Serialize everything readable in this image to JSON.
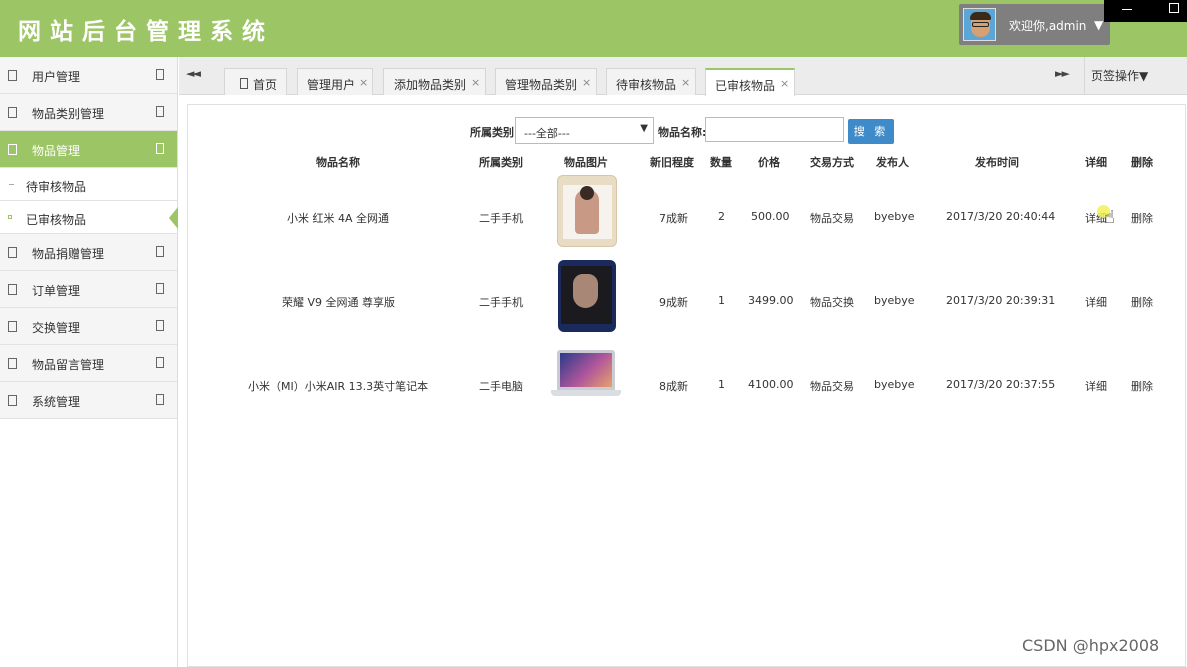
{
  "header": {
    "title": "网站后台管理系统",
    "user": {
      "welcome": "欢迎你,admin",
      "caret": "▼",
      "avatar_icon": "user-avatar"
    },
    "bg_color": "#9cc565"
  },
  "sidebar": {
    "items": [
      {
        "label": "用户管理"
      },
      {
        "label": "物品类别管理"
      },
      {
        "label": "物品管理",
        "active": true
      },
      {
        "label": "物品捐赠管理"
      },
      {
        "label": "订单管理"
      },
      {
        "label": "交换管理"
      },
      {
        "label": "物品留言管理"
      },
      {
        "label": "系统管理"
      }
    ],
    "subitems": [
      {
        "label": "待审核物品"
      },
      {
        "label": "已审核物品",
        "current": true
      }
    ]
  },
  "tabs": {
    "prev": "◄◄",
    "next": "►►",
    "ops_label": "页签操作▼",
    "items": [
      {
        "label": "首页",
        "closable": false
      },
      {
        "label": "管理用户",
        "closable": true
      },
      {
        "label": "添加物品类别",
        "closable": true
      },
      {
        "label": "管理物品类别",
        "closable": true
      },
      {
        "label": "待审核物品",
        "closable": true
      },
      {
        "label": "已审核物品",
        "closable": true,
        "active": true
      }
    ],
    "close_glyph": "×"
  },
  "search": {
    "category_label": "所属类别",
    "category_value": "---全部---",
    "select_caret": "▼",
    "name_label": "物品名称:",
    "name_value": "",
    "button_label": "搜 索",
    "button_color": "#3f8bc9"
  },
  "table": {
    "headers": [
      "物品名称",
      "所属类别",
      "物品图片",
      "新旧程度",
      "数量",
      "价格",
      "交易方式",
      "发布人",
      "发布时间",
      "详细",
      "删除"
    ],
    "rows": [
      {
        "name": "小米 红米 4A 全网通",
        "category": "二手手机",
        "image": "phone-gold-image",
        "condition": "7成新",
        "qty": "2",
        "price": "500.00",
        "trade": "物品交易",
        "publisher": "byebye",
        "time": "2017/3/20 20:40:44",
        "detail": "详细",
        "delete": "删除"
      },
      {
        "name": "荣耀 V9 全网通 尊享版",
        "category": "二手手机",
        "image": "phone-blue-image",
        "condition": "9成新",
        "qty": "1",
        "price": "3499.00",
        "trade": "物品交换",
        "publisher": "byebye",
        "time": "2017/3/20 20:39:31",
        "detail": "详细",
        "delete": "删除"
      },
      {
        "name": "小米（MI）小米AIR 13.3英寸笔记本",
        "category": "二手电脑",
        "image": "laptop-image",
        "condition": "8成新",
        "qty": "1",
        "price": "4100.00",
        "trade": "物品交易",
        "publisher": "byebye",
        "time": "2017/3/20 20:37:55",
        "detail": "详细",
        "delete": "删除"
      }
    ]
  },
  "watermark": "CSDN @hpx2008"
}
